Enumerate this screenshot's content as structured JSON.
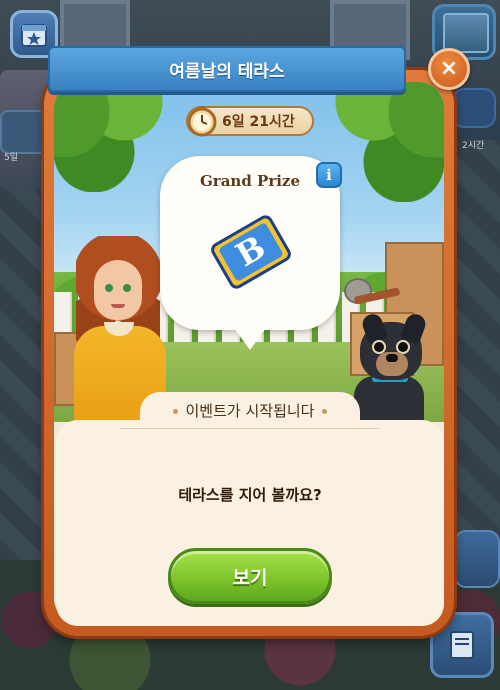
{
  "popup": {
    "title": "여름날의 테라스",
    "close_label": "×",
    "timer": "6일 21시간",
    "prize_title": "Grand Prize",
    "info_label": "i",
    "heading": "이벤트가 시작됩니다",
    "message": "테라스를 지어 볼까요?",
    "button_label": "보기"
  },
  "hud": {
    "left_label": "5일",
    "right_label": "2시간"
  },
  "icons": {
    "calendar": "calendar-star-icon",
    "shop": "shop-box-icon",
    "gift": "gift-icon",
    "mail": "mail-icon",
    "book": "book-icon",
    "timer": "stopwatch-icon",
    "card": "letter-b-card-icon",
    "close": "close-icon",
    "info": "info-icon"
  },
  "colors": {
    "ribbon": "#3a82c2",
    "frame": "#d86a2a",
    "button": "#7fc52c",
    "panel": "#fbf1e3"
  }
}
